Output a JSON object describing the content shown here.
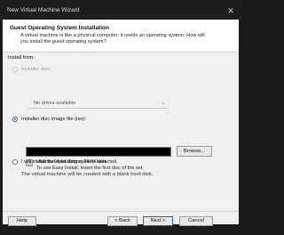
{
  "window": {
    "title": "New Virtual Machine Wizard"
  },
  "header": {
    "title": "Guest Operating System Installation",
    "subtitle": "A virtual machine is like a physical computer; it needs an operating system. How will you install the guest operating system?"
  },
  "install_from": {
    "label": "Install from:",
    "disc": {
      "label": "Installer disc:",
      "selected": "No drives available"
    },
    "iso": {
      "label": "Installer disc image file (iso):",
      "browse": "Browse...",
      "detected_line1": "Ubuntu 64-bit Server 24.04 detected.",
      "detected_line2": "To use Easy Install, insert the first disc of the set."
    },
    "later": {
      "label": "I will install the operating system later.",
      "desc": "The virtual machine will be created with a blank hard disk."
    }
  },
  "buttons": {
    "help": "Help",
    "back": "< Back",
    "next": "Next >",
    "cancel": "Cancel"
  }
}
